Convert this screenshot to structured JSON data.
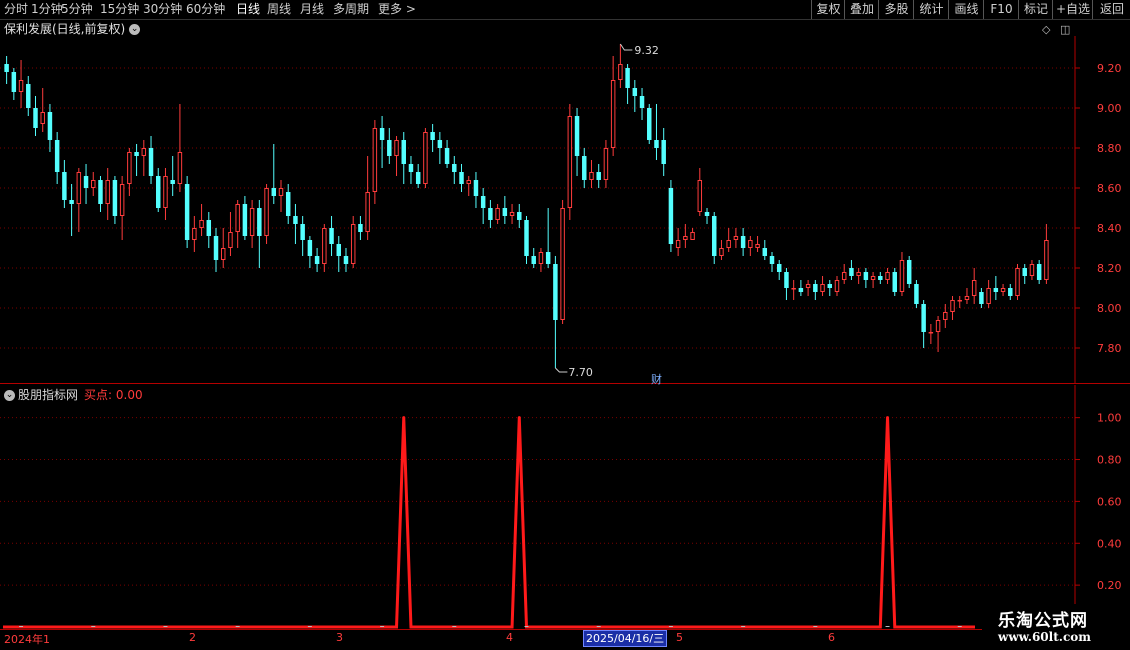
{
  "toolbar": {
    "periods": [
      "分时",
      "1分钟",
      "5分钟",
      "15分钟",
      "30分钟",
      "60分钟",
      "日线",
      "周线",
      "月线",
      "多周期",
      "更多 >"
    ],
    "active_period": "日线",
    "right_buttons": [
      "复权",
      "叠加",
      "多股",
      "统计",
      "画线",
      "F10",
      "标记",
      "+自选",
      "返回"
    ]
  },
  "main_chart": {
    "title": "保利发展(日线,前复权)",
    "high_label": "9.32",
    "low_label": "7.70",
    "event_marker": "财",
    "y_ticks": [
      "9.20",
      "9.00",
      "8.80",
      "8.60",
      "8.40",
      "8.20",
      "8.00",
      "7.80"
    ],
    "y_tick_values": [
      9.2,
      9.0,
      8.8,
      8.6,
      8.4,
      8.2,
      8.0,
      7.8
    ]
  },
  "indicator": {
    "name": "股朋指标网",
    "value_label": "买点: 0.00",
    "y_ticks": [
      "1.00",
      "0.80",
      "0.60",
      "0.40",
      "0.20"
    ],
    "y_tick_values": [
      1.0,
      0.8,
      0.6,
      0.4,
      0.2
    ]
  },
  "date_axis": {
    "labels": [
      "2024年1",
      "2",
      "3",
      "4",
      "5",
      "6"
    ],
    "selected_date": "2025/04/16/三"
  },
  "watermark": {
    "line1": "乐淘公式网",
    "line2": "www.60lt.com"
  },
  "colors": {
    "up": "#ff3c3c",
    "down": "#54ffff",
    "grid": "#7a0000",
    "axis": "#b40000"
  },
  "chart_data": {
    "type": "candlestick",
    "ylim": [
      7.62,
      9.36
    ],
    "candles": [
      [
        9.22,
        9.18,
        9.26,
        9.12
      ],
      [
        9.18,
        9.08,
        9.2,
        9.04
      ],
      [
        9.08,
        9.14,
        9.24,
        9.0
      ],
      [
        9.12,
        9.0,
        9.16,
        8.96
      ],
      [
        9.0,
        8.9,
        9.06,
        8.86
      ],
      [
        8.92,
        8.98,
        9.1,
        8.88
      ],
      [
        8.98,
        8.84,
        9.02,
        8.78
      ],
      [
        8.84,
        8.68,
        8.88,
        8.62
      ],
      [
        8.68,
        8.54,
        8.74,
        8.5
      ],
      [
        8.54,
        8.52,
        8.62,
        8.36
      ],
      [
        8.52,
        8.68,
        8.7,
        8.38
      ],
      [
        8.66,
        8.6,
        8.72,
        8.52
      ],
      [
        8.6,
        8.64,
        8.68,
        8.56
      ],
      [
        8.64,
        8.52,
        8.66,
        8.48
      ],
      [
        8.52,
        8.64,
        8.7,
        8.44
      ],
      [
        8.64,
        8.46,
        8.66,
        8.42
      ],
      [
        8.46,
        8.62,
        8.66,
        8.34
      ],
      [
        8.62,
        8.78,
        8.8,
        8.56
      ],
      [
        8.78,
        8.76,
        8.82,
        8.66
      ],
      [
        8.76,
        8.8,
        8.84,
        8.66
      ],
      [
        8.8,
        8.66,
        8.86,
        8.62
      ],
      [
        8.66,
        8.5,
        8.7,
        8.48
      ],
      [
        8.5,
        8.66,
        8.7,
        8.44
      ],
      [
        8.64,
        8.62,
        8.76,
        8.56
      ],
      [
        8.62,
        8.78,
        9.02,
        8.58
      ],
      [
        8.62,
        8.34,
        8.66,
        8.3
      ],
      [
        8.34,
        8.4,
        8.46,
        8.28
      ],
      [
        8.4,
        8.44,
        8.52,
        8.36
      ],
      [
        8.44,
        8.36,
        8.48,
        8.3
      ],
      [
        8.36,
        8.24,
        8.4,
        8.18
      ],
      [
        8.24,
        8.3,
        8.4,
        8.2
      ],
      [
        8.3,
        8.38,
        8.48,
        8.26
      ],
      [
        8.38,
        8.52,
        8.54,
        8.3
      ],
      [
        8.52,
        8.36,
        8.56,
        8.34
      ],
      [
        8.36,
        8.5,
        8.54,
        8.3
      ],
      [
        8.5,
        8.36,
        8.54,
        8.2
      ],
      [
        8.36,
        8.6,
        8.62,
        8.32
      ],
      [
        8.6,
        8.56,
        8.82,
        8.52
      ],
      [
        8.56,
        8.6,
        8.64,
        8.48
      ],
      [
        8.58,
        8.46,
        8.62,
        8.42
      ],
      [
        8.46,
        8.42,
        8.52,
        8.32
      ],
      [
        8.42,
        8.34,
        8.46,
        8.26
      ],
      [
        8.34,
        8.26,
        8.36,
        8.2
      ],
      [
        8.26,
        8.22,
        8.3,
        8.18
      ],
      [
        8.22,
        8.4,
        8.42,
        8.18
      ],
      [
        8.4,
        8.32,
        8.46,
        8.26
      ],
      [
        8.32,
        8.26,
        8.36,
        8.18
      ],
      [
        8.26,
        8.22,
        8.3,
        8.18
      ],
      [
        8.22,
        8.42,
        8.46,
        8.2
      ],
      [
        8.42,
        8.38,
        8.46,
        8.34
      ],
      [
        8.38,
        8.58,
        8.76,
        8.34
      ],
      [
        8.58,
        8.9,
        8.94,
        8.52
      ],
      [
        8.9,
        8.84,
        8.96,
        8.7
      ],
      [
        8.84,
        8.76,
        8.9,
        8.72
      ],
      [
        8.76,
        8.84,
        8.86,
        8.66
      ],
      [
        8.84,
        8.72,
        8.88,
        8.62
      ],
      [
        8.72,
        8.68,
        8.76,
        8.62
      ],
      [
        8.68,
        8.62,
        8.72,
        8.6
      ],
      [
        8.62,
        8.88,
        8.9,
        8.6
      ],
      [
        8.88,
        8.84,
        8.92,
        8.78
      ],
      [
        8.84,
        8.8,
        8.88,
        8.72
      ],
      [
        8.8,
        8.72,
        8.84,
        8.7
      ],
      [
        8.72,
        8.68,
        8.76,
        8.62
      ],
      [
        8.68,
        8.62,
        8.72,
        8.58
      ],
      [
        8.62,
        8.64,
        8.66,
        8.56
      ],
      [
        8.64,
        8.56,
        8.68,
        8.5
      ],
      [
        8.56,
        8.5,
        8.6,
        8.42
      ],
      [
        8.5,
        8.44,
        8.54,
        8.4
      ],
      [
        8.44,
        8.5,
        8.52,
        8.42
      ],
      [
        8.5,
        8.46,
        8.56,
        8.42
      ],
      [
        8.46,
        8.48,
        8.52,
        8.42
      ],
      [
        8.48,
        8.44,
        8.52,
        8.4
      ],
      [
        8.44,
        8.26,
        8.46,
        8.22
      ],
      [
        8.26,
        8.22,
        8.3,
        8.2
      ],
      [
        8.22,
        8.28,
        8.3,
        8.18
      ],
      [
        8.28,
        8.22,
        8.5,
        8.2
      ],
      [
        8.22,
        7.94,
        8.26,
        7.7
      ],
      [
        7.94,
        8.5,
        8.54,
        7.92
      ],
      [
        8.5,
        8.96,
        9.02,
        8.44
      ],
      [
        8.96,
        8.76,
        9.0,
        8.66
      ],
      [
        8.76,
        8.64,
        8.8,
        8.6
      ],
      [
        8.64,
        8.68,
        8.74,
        8.6
      ],
      [
        8.68,
        8.64,
        8.72,
        8.6
      ],
      [
        8.64,
        8.8,
        8.84,
        8.6
      ],
      [
        8.8,
        9.14,
        9.26,
        8.76
      ],
      [
        9.14,
        9.22,
        9.32,
        9.1
      ],
      [
        9.2,
        9.1,
        9.22,
        9.02
      ],
      [
        9.1,
        9.06,
        9.14,
        8.98
      ],
      [
        9.06,
        9.0,
        9.1,
        8.94
      ],
      [
        9.0,
        8.84,
        9.02,
        8.82
      ],
      [
        8.84,
        8.8,
        9.02,
        8.74
      ],
      [
        8.84,
        8.72,
        8.9,
        8.66
      ],
      [
        8.6,
        8.32,
        8.64,
        8.28
      ],
      [
        8.3,
        8.34,
        8.4,
        8.26
      ],
      [
        8.34,
        8.36,
        8.42,
        8.3
      ],
      [
        8.34,
        8.38,
        8.4,
        8.34
      ],
      [
        8.48,
        8.64,
        8.7,
        8.46
      ],
      [
        8.48,
        8.46,
        8.5,
        8.42
      ],
      [
        8.46,
        8.26,
        8.48,
        8.22
      ],
      [
        8.26,
        8.3,
        8.34,
        8.24
      ],
      [
        8.3,
        8.34,
        8.4,
        8.28
      ],
      [
        8.34,
        8.36,
        8.4,
        8.3
      ],
      [
        8.36,
        8.3,
        8.4,
        8.26
      ],
      [
        8.3,
        8.34,
        8.36,
        8.26
      ],
      [
        8.3,
        8.32,
        8.36,
        8.28
      ],
      [
        8.3,
        8.26,
        8.34,
        8.24
      ],
      [
        8.26,
        8.22,
        8.28,
        8.18
      ],
      [
        8.22,
        8.18,
        8.24,
        8.14
      ],
      [
        8.18,
        8.1,
        8.2,
        8.04
      ],
      [
        8.1,
        8.1,
        8.14,
        8.04
      ],
      [
        8.1,
        8.08,
        8.14,
        8.06
      ],
      [
        8.1,
        8.12,
        8.14,
        8.06
      ],
      [
        8.12,
        8.08,
        8.14,
        8.04
      ],
      [
        8.08,
        8.12,
        8.16,
        8.06
      ],
      [
        8.12,
        8.1,
        8.14,
        8.06
      ],
      [
        8.08,
        8.14,
        8.16,
        8.06
      ],
      [
        8.14,
        8.18,
        8.22,
        8.12
      ],
      [
        8.2,
        8.16,
        8.24,
        8.14
      ],
      [
        8.16,
        8.18,
        8.2,
        8.12
      ],
      [
        8.18,
        8.14,
        8.2,
        8.1
      ],
      [
        8.14,
        8.16,
        8.18,
        8.1
      ],
      [
        8.16,
        8.14,
        8.18,
        8.12
      ],
      [
        8.14,
        8.18,
        8.2,
        8.12
      ],
      [
        8.18,
        8.08,
        8.2,
        8.06
      ],
      [
        8.08,
        8.24,
        8.28,
        8.06
      ],
      [
        8.24,
        8.12,
        8.26,
        8.1
      ],
      [
        8.12,
        8.02,
        8.14,
        8.0
      ],
      [
        8.02,
        7.88,
        8.04,
        7.8
      ],
      [
        7.88,
        7.88,
        7.92,
        7.82
      ],
      [
        7.88,
        7.94,
        7.96,
        7.78
      ],
      [
        7.94,
        7.98,
        8.02,
        7.9
      ],
      [
        7.98,
        8.04,
        8.06,
        7.94
      ],
      [
        8.04,
        8.04,
        8.06,
        8.0
      ],
      [
        8.04,
        8.06,
        8.1,
        8.02
      ],
      [
        8.06,
        8.14,
        8.2,
        8.02
      ],
      [
        8.08,
        8.02,
        8.1,
        8.0
      ],
      [
        8.02,
        8.1,
        8.14,
        8.0
      ],
      [
        8.1,
        8.08,
        8.16,
        8.04
      ],
      [
        8.08,
        8.1,
        8.12,
        8.06
      ],
      [
        8.1,
        8.06,
        8.12,
        8.04
      ],
      [
        8.06,
        8.2,
        8.22,
        8.04
      ],
      [
        8.2,
        8.16,
        8.22,
        8.12
      ],
      [
        8.16,
        8.22,
        8.24,
        8.14
      ],
      [
        8.22,
        8.14,
        8.24,
        8.12
      ],
      [
        8.14,
        8.34,
        8.42,
        8.12
      ]
    ],
    "buy_signal": {
      "ylim": [
        0,
        1.07
      ],
      "spikes": [
        {
          "index": 55,
          "value": 1.0
        },
        {
          "index": 71,
          "value": 1.0
        },
        {
          "index": 122,
          "value": 1.0
        }
      ],
      "baseline": 0.0
    }
  }
}
